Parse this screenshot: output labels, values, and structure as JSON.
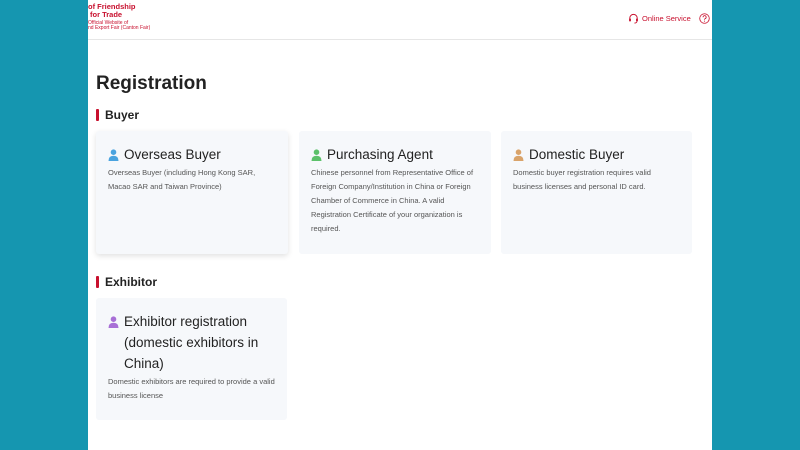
{
  "header": {
    "logo_line1": "of Friendship",
    "logo_line2": "for Trade",
    "logo_line3": "Official Website of",
    "logo_line4": "nd Export Fair (Canton Fair)",
    "online_service_label": "Online Service",
    "icons": [
      "headset-icon",
      "help-icon"
    ]
  },
  "page_title": "Registration",
  "sections": {
    "buyer": {
      "title": "Buyer",
      "cards": [
        {
          "title": "Overseas Buyer",
          "desc": "Overseas Buyer (including Hong Kong SAR, Macao SAR and Taiwan Province)",
          "icon_color": "#4aa3df"
        },
        {
          "title": "Purchasing Agent",
          "desc": "Chinese personnel from Representative Office of Foreign Company/Institution in China or Foreign Chamber of Commerce in China. A valid Registration Certificate of your organization is required.",
          "icon_color": "#5cc16a"
        },
        {
          "title": "Domestic Buyer",
          "desc": "Domestic buyer registration requires valid business licenses and personal ID card.",
          "icon_color": "#d9a36a"
        }
      ]
    },
    "exhibitor": {
      "title": "Exhibitor",
      "cards": [
        {
          "title": "Exhibitor registration (domestic exhibitors in China)",
          "desc": "Domestic exhibitors are required to provide a valid business license",
          "icon_color": "#a86fd6"
        }
      ]
    }
  },
  "colors": {
    "accent": "#c8102e",
    "background": "#1596b0",
    "card": "#f6f8fb"
  }
}
